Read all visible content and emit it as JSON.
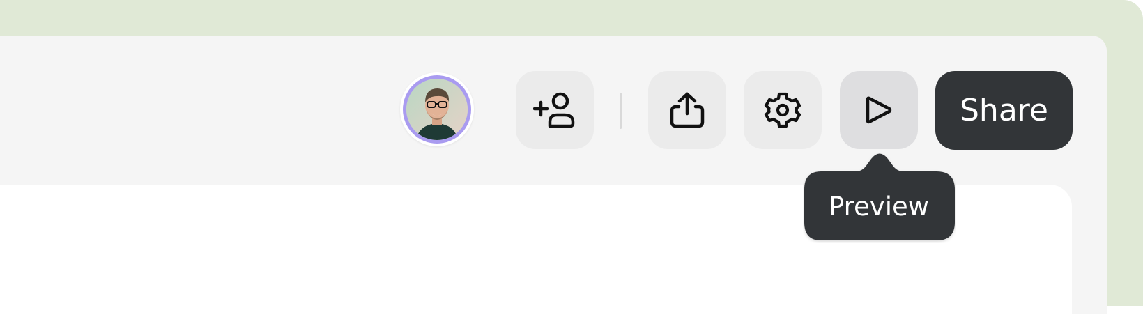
{
  "header": {
    "avatar_icon": "user-avatar-photo",
    "add_person_icon": "person-add-icon",
    "export_icon": "upload-share-icon",
    "settings_icon": "gear-icon",
    "preview_icon": "play-icon",
    "share_label": "Share"
  },
  "tooltip": {
    "label": "Preview"
  },
  "colors": {
    "outer_background": "#e0e9d6",
    "window_background": "#f5f5f5",
    "content_background": "#ffffff",
    "icon_button": "#ebebeb",
    "dark_accent": "#323538",
    "avatar_ring": "#a99bf0"
  }
}
